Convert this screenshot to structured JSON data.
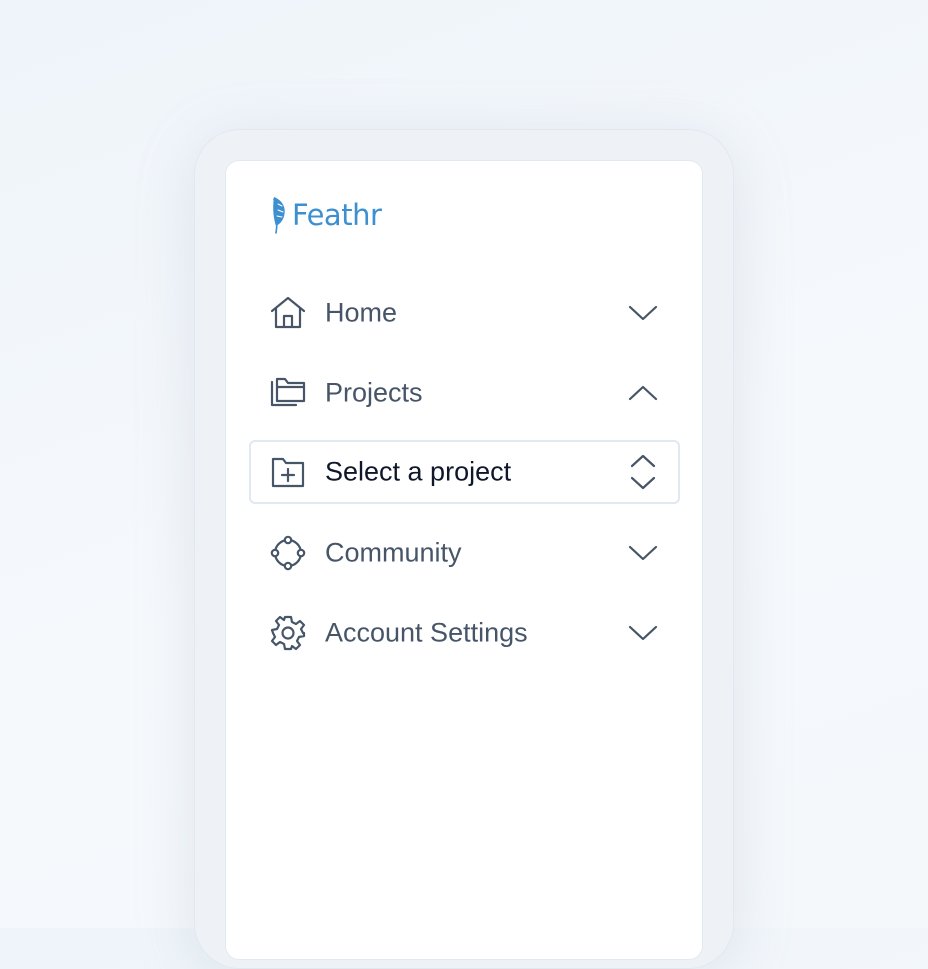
{
  "app": {
    "name": "Feathr"
  },
  "nav": {
    "items": [
      {
        "label": "Home",
        "icon": "home-icon",
        "chevron": "chevron-down-icon"
      },
      {
        "label": "Projects",
        "icon": "folders-icon",
        "chevron": "chevron-up-icon"
      },
      {
        "label": "Select a project",
        "icon": "folder-plus-icon",
        "chevron": "selector-icon"
      },
      {
        "label": "Community",
        "icon": "community-icon",
        "chevron": "chevron-down-icon"
      },
      {
        "label": "Account Settings",
        "icon": "gear-icon",
        "chevron": "chevron-down-icon"
      }
    ]
  },
  "colors": {
    "brand": "#3d8fd0",
    "text": "#475569",
    "text_strong": "#0f172a",
    "border": "#e2e8f0"
  }
}
